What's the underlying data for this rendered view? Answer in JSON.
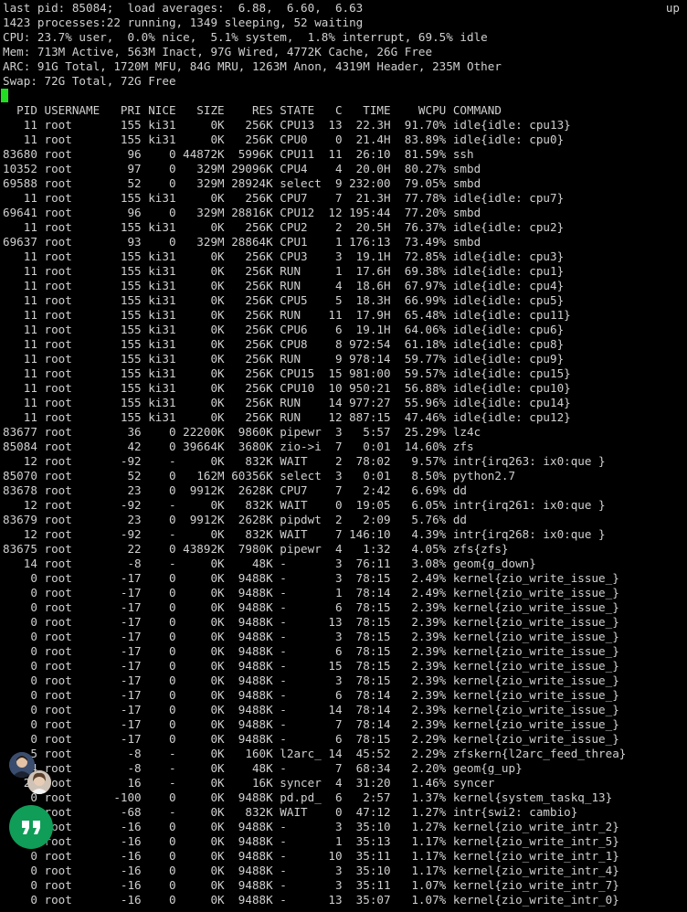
{
  "colors": {
    "background": "#000000",
    "text": "#d0d0d0",
    "cursor": "#22dd22",
    "hangouts": "#0f9d58"
  },
  "header": {
    "lines": [
      "last pid: 85084;  load averages:  6.88,  6.60,  6.63",
      "1423 processes:22 running, 1349 sleeping, 52 waiting",
      "CPU: 23.7% user,  0.0% nice,  5.1% system,  1.8% interrupt, 69.5% idle",
      "Mem: 713M Active, 563M Inact, 97G Wired, 4772K Cache, 26G Free",
      "ARC: 91G Total, 1720M MFU, 84G MRU, 1263M Anon, 4319M Header, 235M Other",
      "Swap: 72G Total, 72G Free"
    ],
    "uptime": "up"
  },
  "table": {
    "header": "  PID USERNAME   PRI NICE   SIZE    RES STATE   C   TIME    WCPU COMMAND",
    "rows": [
      "   11 root       155 ki31     0K   256K CPU13  13  22.3H  91.70% idle{idle: cpu13}",
      "   11 root       155 ki31     0K   256K CPU0    0  21.4H  83.89% idle{idle: cpu0}",
      "83680 root        96    0 44872K  5996K CPU11  11  26:10  81.59% ssh",
      "10352 root        97    0   329M 29096K CPU4    4  20.0H  80.27% smbd",
      "69588 root        52    0   329M 28924K select  9 232:00  79.05% smbd",
      "   11 root       155 ki31     0K   256K CPU7    7  21.3H  77.78% idle{idle: cpu7}",
      "69641 root        96    0   329M 28816K CPU12  12 195:44  77.20% smbd",
      "   11 root       155 ki31     0K   256K CPU2    2  20.5H  76.37% idle{idle: cpu2}",
      "69637 root        93    0   329M 28864K CPU1    1 176:13  73.49% smbd",
      "   11 root       155 ki31     0K   256K CPU3    3  19.1H  72.85% idle{idle: cpu3}",
      "   11 root       155 ki31     0K   256K RUN     1  17.6H  69.38% idle{idle: cpu1}",
      "   11 root       155 ki31     0K   256K RUN     4  18.6H  67.97% idle{idle: cpu4}",
      "   11 root       155 ki31     0K   256K CPU5    5  18.3H  66.99% idle{idle: cpu5}",
      "   11 root       155 ki31     0K   256K RUN    11  17.9H  65.48% idle{idle: cpu11}",
      "   11 root       155 ki31     0K   256K CPU6    6  19.1H  64.06% idle{idle: cpu6}",
      "   11 root       155 ki31     0K   256K CPU8    8 972:54  61.18% idle{idle: cpu8}",
      "   11 root       155 ki31     0K   256K RUN     9 978:14  59.77% idle{idle: cpu9}",
      "   11 root       155 ki31     0K   256K CPU15  15 981:00  59.57% idle{idle: cpu15}",
      "   11 root       155 ki31     0K   256K CPU10  10 950:21  56.88% idle{idle: cpu10}",
      "   11 root       155 ki31     0K   256K RUN    14 977:27  55.96% idle{idle: cpu14}",
      "   11 root       155 ki31     0K   256K RUN    12 887:15  47.46% idle{idle: cpu12}",
      "83677 root        36    0 22200K  9860K pipewr  3   5:57  25.29% lz4c",
      "85084 root        42    0 39664K  3680K zio->i  7   0:01  14.60% zfs",
      "   12 root       -92    -     0K   832K WAIT    2  78:02   9.57% intr{irq263: ix0:que }",
      "85070 root        52    0   162M 60356K select  3   0:01   8.50% python2.7",
      "83678 root        23    0  9912K  2628K CPU7    7   2:42   6.69% dd",
      "   12 root       -92    -     0K   832K WAIT    0  19:05   6.05% intr{irq261: ix0:que }",
      "83679 root        23    0  9912K  2628K pipdwt  2   2:09   5.76% dd",
      "   12 root       -92    -     0K   832K WAIT    7 146:10   4.39% intr{irq268: ix0:que }",
      "83675 root        22    0 43892K  7980K pipewr  4   1:32   4.05% zfs{zfs}",
      "   14 root        -8    -     0K    48K -       3  76:11   3.08% geom{g_down}",
      "    0 root       -17    0     0K  9488K -       3  78:15   2.49% kernel{zio_write_issue_}",
      "    0 root       -17    0     0K  9488K -       1  78:14   2.49% kernel{zio_write_issue_}",
      "    0 root       -17    0     0K  9488K -       6  78:15   2.39% kernel{zio_write_issue_}",
      "    0 root       -17    0     0K  9488K -      13  78:15   2.39% kernel{zio_write_issue_}",
      "    0 root       -17    0     0K  9488K -       3  78:15   2.39% kernel{zio_write_issue_}",
      "    0 root       -17    0     0K  9488K -       6  78:15   2.39% kernel{zio_write_issue_}",
      "    0 root       -17    0     0K  9488K -      15  78:15   2.39% kernel{zio_write_issue_}",
      "    0 root       -17    0     0K  9488K -       3  78:15   2.39% kernel{zio_write_issue_}",
      "    0 root       -17    0     0K  9488K -       6  78:14   2.39% kernel{zio_write_issue_}",
      "    0 root       -17    0     0K  9488K -      14  78:14   2.39% kernel{zio_write_issue_}",
      "    0 root       -17    0     0K  9488K -       7  78:14   2.39% kernel{zio_write_issue_}",
      "    0 root       -17    0     0K  9488K -       6  78:15   2.29% kernel{zio_write_issue_}",
      "    5 root        -8    -     0K   160K l2arc_ 14  45:52   2.29% zfskern{l2arc_feed_threa}",
      "    4 root        -8    -     0K    48K -       7  68:34   2.20% geom{g_up}",
      "   20 root        16    -     0K    16K syncer  4  31:20   1.46% syncer",
      "    0 root      -100    0     0K  9488K pd.pd_  6   2:57   1.37% kernel{system_taskq_13}",
      "   12 root       -68    -     0K   832K WAIT    0  47:12   1.27% intr{swi2: cambio}",
      "    0 root       -16    0     0K  9488K -       3  35:10   1.27% kernel{zio_write_intr_2}",
      "    0 root       -16    0     0K  9488K -       1  35:13   1.17% kernel{zio_write_intr_5}",
      "    0 root       -16    0     0K  9488K -      10  35:11   1.17% kernel{zio_write_intr_1}",
      "    0 root       -16    0     0K  9488K -       3  35:10   1.17% kernel{zio_write_intr_4}",
      "    0 root       -16    0     0K  9488K -       3  35:11   1.07% kernel{zio_write_intr_7}",
      "    0 root       -16    0     0K  9488K -      13  35:07   1.07% kernel{zio_write_intr_0}"
    ]
  },
  "overlay": {
    "icons": [
      "avatar",
      "avatar",
      "hangouts-quote-icon"
    ]
  }
}
